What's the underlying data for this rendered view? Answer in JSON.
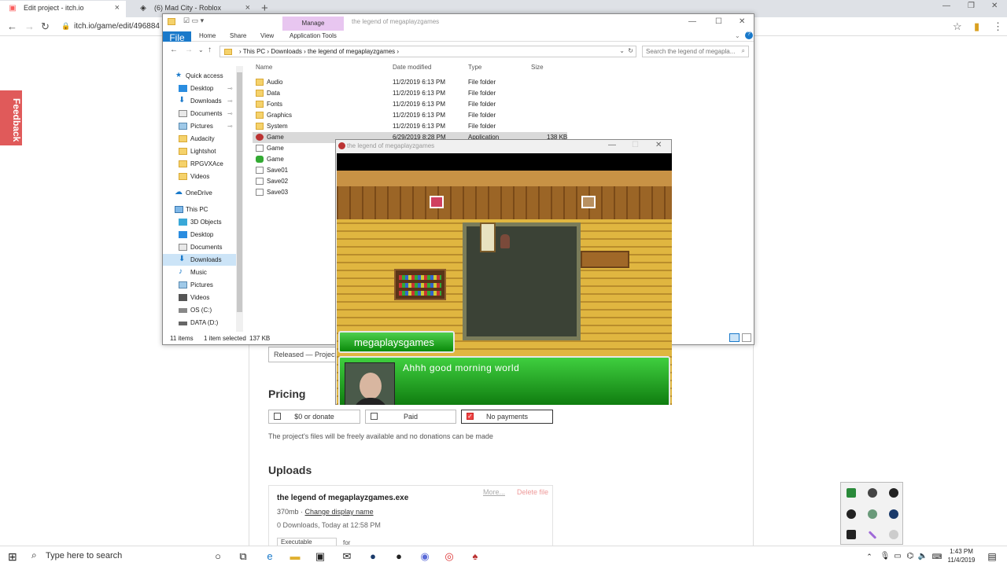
{
  "browser": {
    "tabs": [
      {
        "title": "Edit project - itch.io",
        "active": true
      },
      {
        "title": "(6) Mad City - Roblox",
        "active": false
      }
    ],
    "url": "itch.io/game/edit/496884"
  },
  "feedback_label": "Feedback",
  "itch": {
    "status_value": "Released — Project is",
    "pricing_title": "Pricing",
    "pricing_options": [
      {
        "label": "$0 or donate",
        "checked": false
      },
      {
        "label": "Paid",
        "checked": false
      },
      {
        "label": "No payments",
        "checked": true
      }
    ],
    "pricing_description": "The project's files will be freely available and no donations can be made",
    "uploads_title": "Uploads",
    "upload": {
      "filename": "the legend of megaplayzgames.exe",
      "more": "More...",
      "delete": "Delete file",
      "size": "370mb",
      "change_name": "Change display name",
      "stats": "0 Downloads, Today at 12:58 PM",
      "kind": "Executable",
      "for_label": "for"
    }
  },
  "explorer": {
    "manage_tab": "Manage",
    "window_title": "the legend of megaplayzgames",
    "ribbon_tabs": [
      "File",
      "Home",
      "Share",
      "View",
      "Application Tools"
    ],
    "breadcrumb": [
      "This PC",
      "Downloads",
      "the legend of megaplayzgames"
    ],
    "search_placeholder": "Search the legend of megapla...",
    "columns": [
      "Name",
      "Date modified",
      "Type",
      "Size"
    ],
    "nav": [
      {
        "label": "Quick access",
        "icon": "star-icon"
      },
      {
        "label": "Desktop",
        "icon": "desktop-icon"
      },
      {
        "label": "Downloads",
        "icon": "download-icon"
      },
      {
        "label": "Documents",
        "icon": "documents-icon"
      },
      {
        "label": "Pictures",
        "icon": "pictures-icon"
      },
      {
        "label": "Audacity",
        "icon": "folder-icon"
      },
      {
        "label": "Lightshot",
        "icon": "folder-icon"
      },
      {
        "label": "RPGVXAce",
        "icon": "folder-icon"
      },
      {
        "label": "Videos",
        "icon": "folder-icon"
      },
      {
        "label": "OneDrive",
        "icon": "cloud-icon"
      },
      {
        "label": "This PC",
        "icon": "pc-icon"
      },
      {
        "label": "3D Objects",
        "icon": "cube-icon"
      },
      {
        "label": "Desktop",
        "icon": "desktop-icon"
      },
      {
        "label": "Documents",
        "icon": "documents-icon"
      },
      {
        "label": "Downloads",
        "icon": "download-icon"
      },
      {
        "label": "Music",
        "icon": "music-icon"
      },
      {
        "label": "Pictures",
        "icon": "pictures-icon"
      },
      {
        "label": "Videos",
        "icon": "videos-icon"
      },
      {
        "label": "OS (C:)",
        "icon": "drive-icon"
      },
      {
        "label": "DATA (D:)",
        "icon": "drive-icon"
      }
    ],
    "files": [
      {
        "name": "Audio",
        "date": "11/2/2019 6:13 PM",
        "type": "File folder",
        "size": "",
        "icon": "folder-icon"
      },
      {
        "name": "Data",
        "date": "11/2/2019 6:13 PM",
        "type": "File folder",
        "size": "",
        "icon": "folder-icon"
      },
      {
        "name": "Fonts",
        "date": "11/2/2019 6:13 PM",
        "type": "File folder",
        "size": "",
        "icon": "folder-icon"
      },
      {
        "name": "Graphics",
        "date": "11/2/2019 6:13 PM",
        "type": "File folder",
        "size": "",
        "icon": "folder-icon"
      },
      {
        "name": "System",
        "date": "11/2/2019 6:13 PM",
        "type": "File folder",
        "size": "",
        "icon": "folder-icon"
      },
      {
        "name": "Game",
        "date": "6/29/2019 8:28 PM",
        "type": "Application",
        "size": "138 KB",
        "icon": "game-app-icon",
        "selected": true
      },
      {
        "name": "Game",
        "date": "",
        "type": "",
        "size": "",
        "icon": "file-icon"
      },
      {
        "name": "Game",
        "date": "",
        "type": "",
        "size": "",
        "icon": "rpg-project-icon"
      },
      {
        "name": "Save01",
        "date": "",
        "type": "",
        "size": "",
        "icon": "file-icon"
      },
      {
        "name": "Save02",
        "date": "",
        "type": "",
        "size": "",
        "icon": "file-icon"
      },
      {
        "name": "Save03",
        "date": "",
        "type": "",
        "size": "",
        "icon": "file-icon"
      }
    ],
    "status": {
      "count": "11 items",
      "selected": "1 item selected",
      "size": "137 KB"
    }
  },
  "game": {
    "window_title": "the legend of megaplayzgames",
    "speaker": "megaplaysgames",
    "dialog": "Ahhh good morning world"
  },
  "taskbar": {
    "search_placeholder": "Type here to search",
    "time": "1:43 PM",
    "date": "11/4/2019"
  }
}
